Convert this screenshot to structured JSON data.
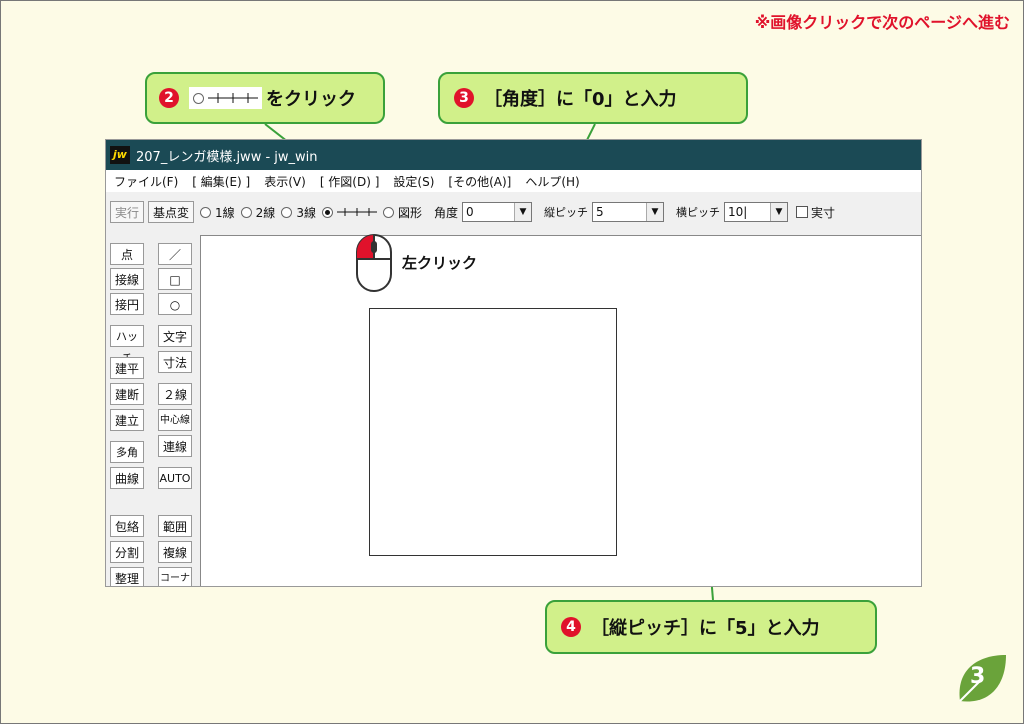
{
  "top_note": "※画像クリックで次のページへ進む",
  "callouts": {
    "c2": {
      "num": "2",
      "text": "をクリック"
    },
    "c3": {
      "num": "3",
      "text": "［角度］に「0」と入力"
    },
    "c4": {
      "num": "4",
      "text": "［縦ピッチ］に「5」と入力"
    }
  },
  "window": {
    "title": "207_レンガ模様.jww - jw_win",
    "app_icon": "jw"
  },
  "menu": [
    "ファイル(F)",
    "[ 編集(E) ]",
    "表示(V)",
    "[ 作図(D) ]",
    "設定(S)",
    "[その他(A)]",
    "ヘルプ(H)"
  ],
  "toolbar": {
    "exec": "実行",
    "base_point": "基点変",
    "radio_1": "1線",
    "radio_2": "2線",
    "radio_3": "3線",
    "radio_5": "図形",
    "angle_label": "角度",
    "angle_value": "0",
    "vpitch_label": "縦ピッチ",
    "vpitch_value": "5",
    "hpitch_label": "横ピッチ",
    "hpitch_value": "10|",
    "actual_label": "実寸"
  },
  "sidebar": {
    "left": [
      "点",
      "接線",
      "接円",
      "ハッチ",
      "建平",
      "建断",
      "建立",
      "多角形",
      "曲線",
      "包絡",
      "分割",
      "整理"
    ],
    "right": [
      "／",
      "□",
      "○",
      "文字",
      "寸法",
      "２線",
      "中心線",
      "連線",
      "AUTO",
      "範囲",
      "複線",
      "コーナー"
    ]
  },
  "mouse_label": "左クリック",
  "page_number": "3",
  "colors": {
    "accent_red": "#e0122b",
    "callout_fill": "#d1f08a",
    "callout_border": "#3aa13a",
    "titlebar": "#1b4a55"
  }
}
